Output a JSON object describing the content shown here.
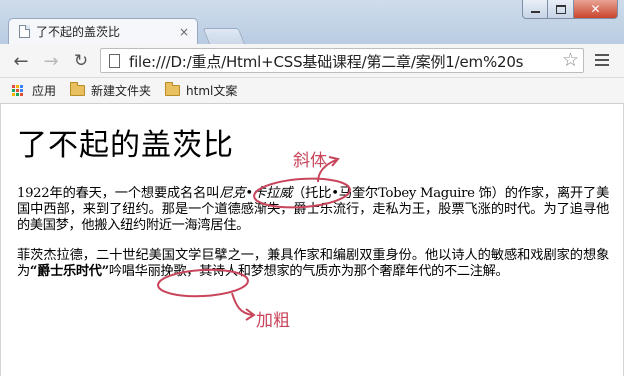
{
  "window": {
    "tab_title": "了不起的盖茨比",
    "tab_close": "×",
    "controls": {
      "close": "✕"
    }
  },
  "toolbar": {
    "back": "←",
    "forward": "→",
    "reload": "↻",
    "url": "file:///D:/重点/Html+CSS基础课程/第二章/案例1/em%20s",
    "star": "☆"
  },
  "bookmarks": [
    {
      "label": "应用",
      "icon": "apps-grid-icon"
    },
    {
      "label": "新建文件夹",
      "icon": "folder-icon"
    },
    {
      "label": "html文案",
      "icon": "folder-icon"
    }
  ],
  "page": {
    "heading": "了不起的盖茨比",
    "p1_before": "1922年的春天，一个想要成名名叫",
    "p1_em": "尼克•卡拉威",
    "p1_after": "（托比•马奎尔Tobey Maguire 饰）的作家，离开了美国中西部，来到了纽约。那是一个道德感渐失，爵士乐流行，走私为王，股票飞涨的时代。为了追寻他的美国梦，他搬入纽约附近一海湾居住。",
    "p2_before": "菲茨杰拉德，二十世纪美国文学巨擘之一，兼具作家和编剧双重身份。他以诗人的敏感和戏剧家的想象为",
    "p2_strong": "“爵士乐时代”",
    "p2_after": "吟唱华丽挽歌，其诗人和梦想家的气质亦为那个奢靡年代的不二注解。"
  },
  "annotations": {
    "italic_label": "斜体",
    "bold_label": "加粗",
    "color": "#c8455b"
  },
  "colors": {
    "apps_grid": [
      "#e04b3a",
      "#f4b400",
      "#3b82f6",
      "#22a35a",
      "#e04b3a",
      "#3b82f6",
      "#f4b400",
      "#22a35a",
      "#e04b3a"
    ]
  }
}
